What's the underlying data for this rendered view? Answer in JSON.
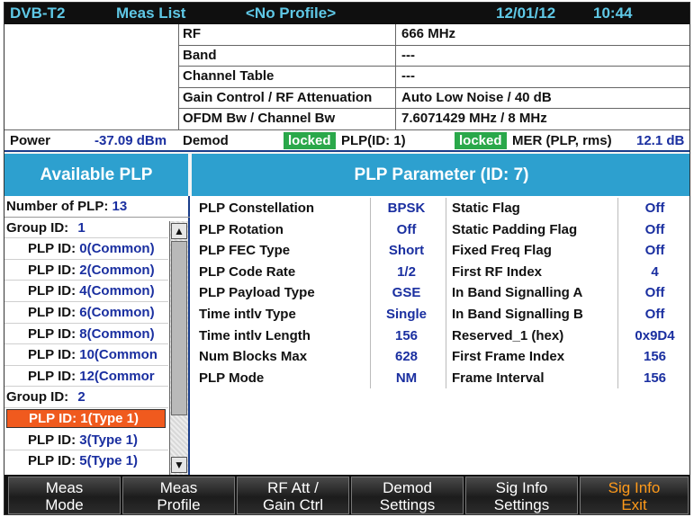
{
  "topbar": {
    "standard": "DVB-T2",
    "view": "Meas List",
    "profile": "<No Profile>",
    "date": "12/01/12",
    "time": "10:44"
  },
  "info": [
    {
      "label": "RF",
      "value": "666 MHz"
    },
    {
      "label": "Band",
      "value": "---"
    },
    {
      "label": "Channel Table",
      "value": "---"
    },
    {
      "label": "Gain Control / RF Attenuation",
      "value": "Auto Low Noise / 40 dB"
    },
    {
      "label": "OFDM Bw / Channel Bw",
      "value": "7.6071429 MHz / 8 MHz"
    }
  ],
  "status": {
    "power_label": "Power",
    "power_value": "-37.09 dBm",
    "demod_label": "Demod",
    "demod_status": "locked",
    "plp_label": "PLP(ID: 1)",
    "plp_status": "locked",
    "mer_label": "MER (PLP, rms)",
    "mer_value": "12.1 dB"
  },
  "left_panel": {
    "header": "Available PLP",
    "number_label": "Number of PLP:",
    "number_value": "13",
    "groups": [
      {
        "label": "Group ID:",
        "id": "1"
      },
      {
        "label": "Group ID:",
        "id": "2"
      }
    ],
    "items": [
      {
        "label": "PLP ID:",
        "value": "0(Common)"
      },
      {
        "label": "PLP ID:",
        "value": "2(Common)"
      },
      {
        "label": "PLP ID:",
        "value": "4(Common)"
      },
      {
        "label": "PLP ID:",
        "value": "6(Common)"
      },
      {
        "label": "PLP ID:",
        "value": "8(Common)"
      },
      {
        "label": "PLP ID:",
        "value": "10(Common"
      },
      {
        "label": "PLP ID:",
        "value": "12(Commor"
      },
      {
        "label": "PLP ID:",
        "value": "1(Type 1)"
      },
      {
        "label": "PLP ID:",
        "value": "3(Type 1)"
      },
      {
        "label": "PLP ID:",
        "value": "5(Type 1)"
      }
    ]
  },
  "params": {
    "header": "PLP Parameter (ID: 7)",
    "rows": [
      {
        "name": "PLP Constellation",
        "value": "BPSK",
        "name2": "Static Flag",
        "value2": "Off"
      },
      {
        "name": "PLP Rotation",
        "value": "Off",
        "name2": "Static Padding Flag",
        "value2": "Off"
      },
      {
        "name": "PLP FEC Type",
        "value": "Short",
        "name2": "Fixed Freq Flag",
        "value2": "Off"
      },
      {
        "name": "PLP Code Rate",
        "value": "1/2",
        "name2": "First RF Index",
        "value2": "4"
      },
      {
        "name": "PLP Payload Type",
        "value": "GSE",
        "name2": "In Band Signalling A",
        "value2": "Off"
      },
      {
        "name": "Time intlv Type",
        "value": "Single",
        "name2": "In Band Signalling B",
        "value2": "Off"
      },
      {
        "name": "Time intlv Length",
        "value": "156",
        "name2": "Reserved_1 (hex)",
        "value2": "0x9D4"
      },
      {
        "name": "Num Blocks Max",
        "value": "628",
        "name2": "First Frame Index",
        "value2": "156"
      },
      {
        "name": "PLP Mode",
        "value": "NM",
        "name2": "Frame Interval",
        "value2": "156"
      }
    ]
  },
  "softkeys": [
    {
      "line1": "Meas",
      "line2": "Mode"
    },
    {
      "line1": "Meas",
      "line2": "Profile"
    },
    {
      "line1": "RF Att /",
      "line2": "Gain Ctrl"
    },
    {
      "line1": "Demod",
      "line2": "Settings"
    },
    {
      "line1": "Sig Info",
      "line2": "Settings"
    },
    {
      "line1": "Sig Info",
      "line2": "Exit"
    }
  ],
  "colors": {
    "header_blue": "#2da0cf",
    "value_blue": "#1a2fa0",
    "locked_green": "#2aa84a",
    "selection_orange": "#f05a1e",
    "exit_orange": "#ff9a1a",
    "topbar_text": "#5fc8e6"
  },
  "scrollbar": {
    "up_icon": "triangle-up",
    "down_icon": "triangle-down"
  }
}
